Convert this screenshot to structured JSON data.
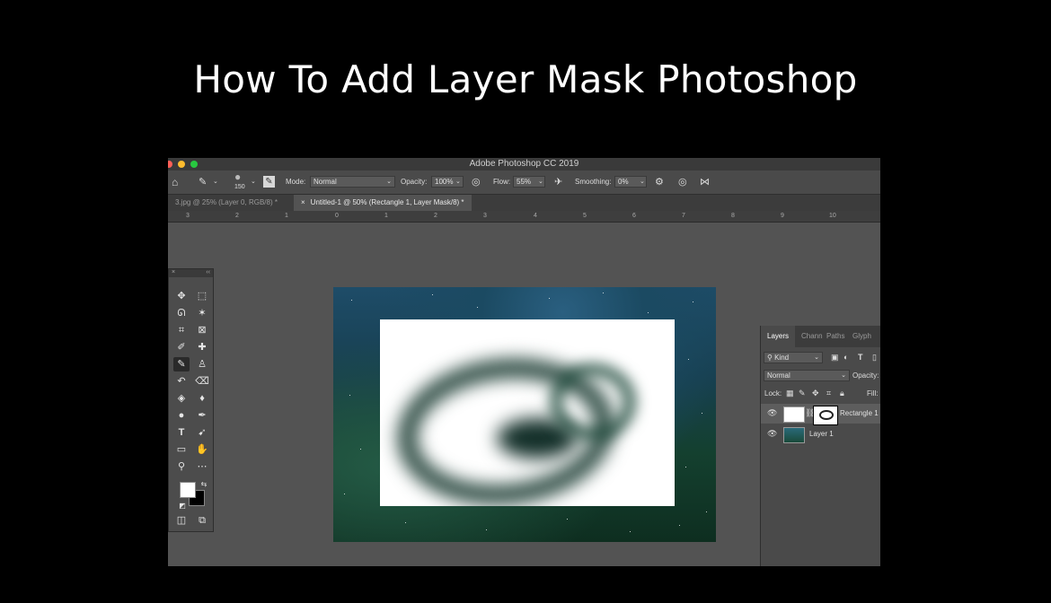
{
  "heading": "How To Add Layer Mask Photoshop",
  "app": {
    "title": "Adobe Photoshop CC 2019",
    "colors": {
      "close": "#ff5f57",
      "minimize": "#febc2e",
      "zoom": "#28c840"
    }
  },
  "options_bar": {
    "brush_size": "150",
    "mode_label": "Mode:",
    "mode_value": "Normal",
    "opacity_label": "Opacity:",
    "opacity_value": "100%",
    "flow_label": "Flow:",
    "flow_value": "55%",
    "smoothing_label": "Smoothing:",
    "smoothing_value": "0%"
  },
  "tabs": [
    {
      "label": "3.jpg @ 25% (Layer 0, RGB/8) *",
      "active": false
    },
    {
      "label": "Untitled-1 @ 50% (Rectangle 1, Layer Mask/8) *",
      "active": true
    }
  ],
  "ruler": [
    "3",
    "2",
    "1",
    "0",
    "1",
    "2",
    "3",
    "4",
    "5",
    "6",
    "7",
    "8",
    "9",
    "10"
  ],
  "toolbox": {
    "close": "×",
    "collapse": "‹‹"
  },
  "layers_panel": {
    "tabs": [
      "Layers",
      "Chann",
      "Paths",
      "Glyph"
    ],
    "filter_label": "Kind",
    "blend_mode": "Normal",
    "opacity_label": "Opacity:",
    "lock_label": "Lock:",
    "fill_label": "Fill:",
    "layers": [
      {
        "name": "Rectangle 1",
        "selected": true
      },
      {
        "name": "Layer 1",
        "selected": false
      }
    ]
  }
}
